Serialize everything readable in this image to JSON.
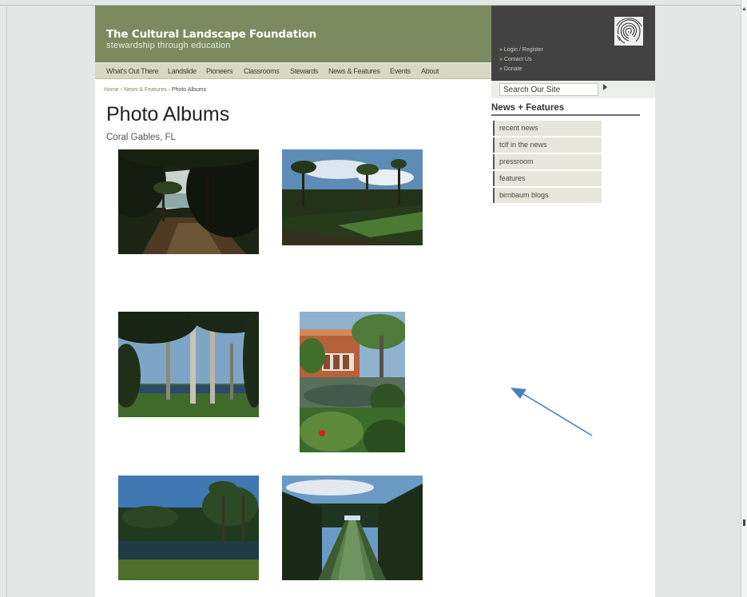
{
  "header": {
    "site_title": "The Cultural Landscape Foundation",
    "tagline": "stewardship through education"
  },
  "nav": {
    "items": [
      "What's Out There",
      "Landslide",
      "Pioneers",
      "Classrooms",
      "Stewards",
      "News & Features",
      "Events",
      "About"
    ]
  },
  "utility_links": [
    "» Login / Register",
    "» Contact Us",
    "» Donate"
  ],
  "search": {
    "placeholder": "Search Our Site"
  },
  "breadcrumb": {
    "home": "Home",
    "section": "News & Features",
    "current": "Photo Albums",
    "separator": "›"
  },
  "main": {
    "title": "Photo Albums",
    "subtitle": "Coral Gables, FL"
  },
  "sidebar": {
    "heading": "News + Features",
    "items": [
      "recent news",
      "tclf in the news",
      "pressroom",
      "features",
      "birnbaum blogs"
    ]
  },
  "colors": {
    "header_green": "#7b8b5f",
    "header_dark": "#424242",
    "nav_bg": "#d8d9c4",
    "annotation_arrow": "#4a7fc1"
  },
  "icons": {
    "logo": "fingerprint-icon",
    "search_go": "play-arrow-icon",
    "annotation": "arrow-icon"
  }
}
